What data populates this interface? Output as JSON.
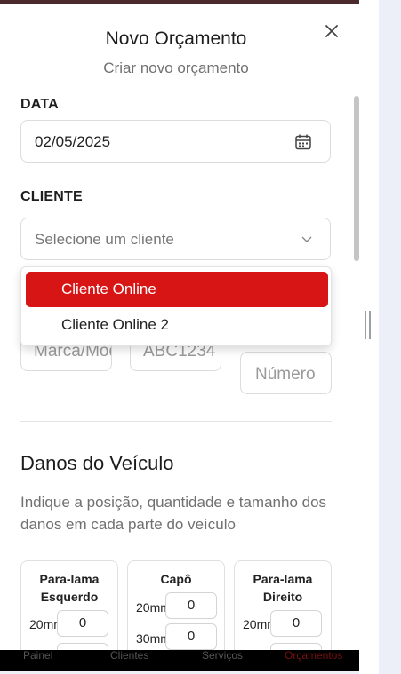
{
  "modal": {
    "title": "Novo Orçamento",
    "subtitle": "Criar novo orçamento"
  },
  "date_field": {
    "label": "DATA",
    "value": "02/05/2025"
  },
  "client_field": {
    "label": "CLIENTE",
    "placeholder": "Selecione um cliente"
  },
  "client_options": [
    {
      "label": "Cliente Online",
      "selected": true
    },
    {
      "label": "Cliente Online 2",
      "selected": false
    }
  ],
  "vehicle_fields": {
    "brand_placeholder": "Marca/Modelo",
    "plate_placeholder": "ABC1234",
    "number_placeholder": "Número"
  },
  "damage_section": {
    "title": "Danos do Veículo",
    "description": "Indique a posição, quantidade e tamanho dos danos em cada parte do veículo",
    "parts": [
      {
        "name": "Para-lama Esquerdo",
        "rows": [
          {
            "size": "20mm",
            "qty": "0"
          },
          {
            "size": "",
            "qty": ""
          }
        ]
      },
      {
        "name": "Capô",
        "rows": [
          {
            "size": "20mm",
            "qty": "0"
          },
          {
            "size": "30mm",
            "qty": "0"
          }
        ]
      },
      {
        "name": "Para-lama Direito",
        "rows": [
          {
            "size": "20mm",
            "qty": "0"
          },
          {
            "size": "",
            "qty": ""
          }
        ]
      }
    ]
  },
  "bottom_nav": {
    "items": [
      "Painel",
      "Clientes",
      "Serviços",
      "Orçamentos"
    ]
  },
  "colors": {
    "accent": "#d71515"
  }
}
